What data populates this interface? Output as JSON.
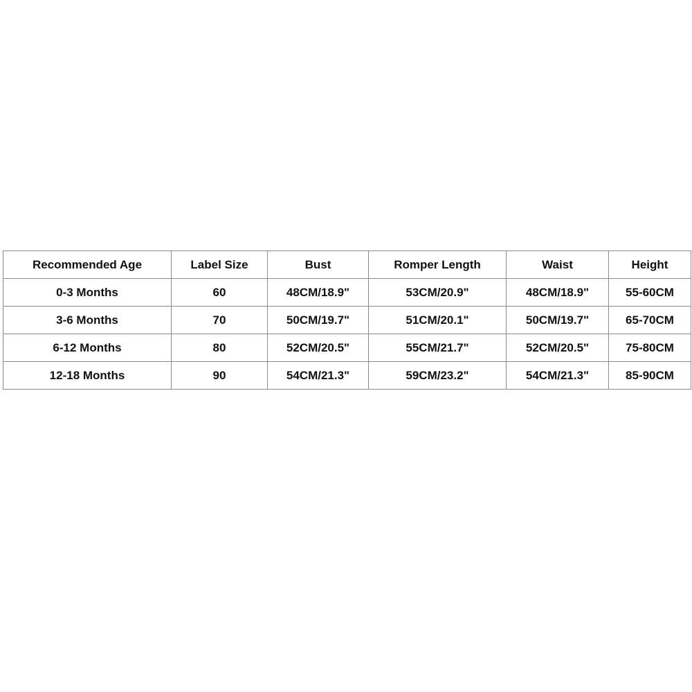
{
  "size_chart": {
    "headers": [
      "Recommended Age",
      "Label Size",
      "Bust",
      "Romper Length",
      "Waist",
      "Height"
    ],
    "rows": [
      [
        "0-3 Months",
        "60",
        "48CM/18.9\"",
        "53CM/20.9\"",
        "48CM/18.9\"",
        "55-60CM"
      ],
      [
        "3-6 Months",
        "70",
        "50CM/19.7\"",
        "51CM/20.1\"",
        "50CM/19.7\"",
        "65-70CM"
      ],
      [
        "6-12 Months",
        "80",
        "52CM/20.5\"",
        "55CM/21.7\"",
        "52CM/20.5\"",
        "75-80CM"
      ],
      [
        "12-18 Months",
        "90",
        "54CM/21.3\"",
        "59CM/23.2\"",
        "54CM/21.3\"",
        "85-90CM"
      ]
    ]
  }
}
